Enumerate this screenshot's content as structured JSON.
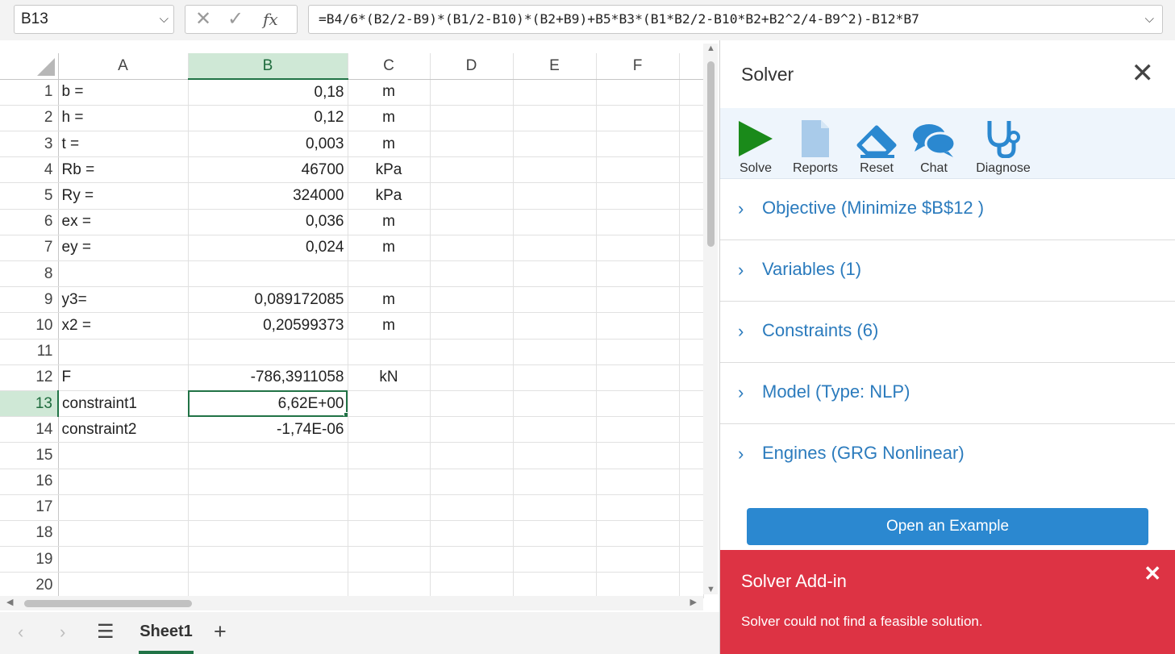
{
  "formula_bar": {
    "name_box": "B13",
    "cancel_glyph": "✕",
    "enter_glyph": "✓",
    "fx_glyph": "fx",
    "formula": "=B4/6*(B2/2-B9)*(B1/2-B10)*(B2+B9)+B5*B3*(B1*B2/2-B10*B2+B2^2/4-B9^2)-B12*B7"
  },
  "sheet": {
    "columns": [
      "A",
      "B",
      "C",
      "D",
      "E",
      "F"
    ],
    "selected_column": "B",
    "active_cell": "B13",
    "rows": [
      {
        "n": "1",
        "a": "b =",
        "b": "0,18",
        "c": "m"
      },
      {
        "n": "2",
        "a": "h =",
        "b": "0,12",
        "c": "m"
      },
      {
        "n": "3",
        "a": "t =",
        "b": "0,003",
        "c": "m"
      },
      {
        "n": "4",
        "a": "Rb =",
        "b": "46700",
        "c": "kPa"
      },
      {
        "n": "5",
        "a": "Ry =",
        "b": "324000",
        "c": "kPa"
      },
      {
        "n": "6",
        "a": "ex =",
        "b": "0,036",
        "c": "m"
      },
      {
        "n": "7",
        "a": "ey =",
        "b": "0,024",
        "c": "m"
      },
      {
        "n": "8",
        "a": "",
        "b": "",
        "c": ""
      },
      {
        "n": "9",
        "a": "y3=",
        "b": "0,089172085",
        "c": "m"
      },
      {
        "n": "10",
        "a": "x2 =",
        "b": "0,20599373",
        "c": "m"
      },
      {
        "n": "11",
        "a": "",
        "b": "",
        "c": ""
      },
      {
        "n": "12",
        "a": "F",
        "b": "-786,3911058",
        "c": "kN"
      },
      {
        "n": "13",
        "a": "constraint1",
        "b": "6,62E+00",
        "c": ""
      },
      {
        "n": "14",
        "a": "constraint2",
        "b": "-1,74E-06",
        "c": ""
      },
      {
        "n": "15",
        "a": "",
        "b": "",
        "c": ""
      },
      {
        "n": "16",
        "a": "",
        "b": "",
        "c": ""
      },
      {
        "n": "17",
        "a": "",
        "b": "",
        "c": ""
      },
      {
        "n": "18",
        "a": "",
        "b": "",
        "c": ""
      },
      {
        "n": "19",
        "a": "",
        "b": "",
        "c": ""
      },
      {
        "n": "20",
        "a": "",
        "b": "",
        "c": ""
      }
    ]
  },
  "tabs": {
    "sheet_name": "Sheet1",
    "menu_glyph": "☰",
    "add_glyph": "+",
    "prev_glyph": "‹",
    "next_glyph": "›"
  },
  "solver": {
    "title": "Solver",
    "close_glyph": "✕",
    "ribbon": [
      {
        "id": "solve",
        "label": "Solve",
        "icon": "play-icon"
      },
      {
        "id": "reports",
        "label": "Reports",
        "icon": "document-icon"
      },
      {
        "id": "reset",
        "label": "Reset",
        "icon": "eraser-icon"
      },
      {
        "id": "chat",
        "label": "Chat",
        "icon": "chat-icon"
      },
      {
        "id": "diagnose",
        "label": "Diagnose",
        "icon": "stethoscope-icon"
      }
    ],
    "sections": [
      "Objective (Minimize $B$12 )",
      "Variables (1)",
      "Constraints (6)",
      "Model (Type: NLP)",
      "Engines (GRG Nonlinear)"
    ],
    "caret_glyph": "›",
    "example_button": "Open an Example",
    "toast": {
      "title": "Solver Add-in",
      "message": "Solver could not find a feasible solution.",
      "close_glyph": "✕"
    }
  },
  "colors": {
    "excel_green": "#217346",
    "solver_blue": "#2b7bbd",
    "button_blue": "#2b88d0",
    "error_red": "#dd3344",
    "solve_green": "#1a8a1a",
    "icon_light_blue": "#a9cbea"
  }
}
